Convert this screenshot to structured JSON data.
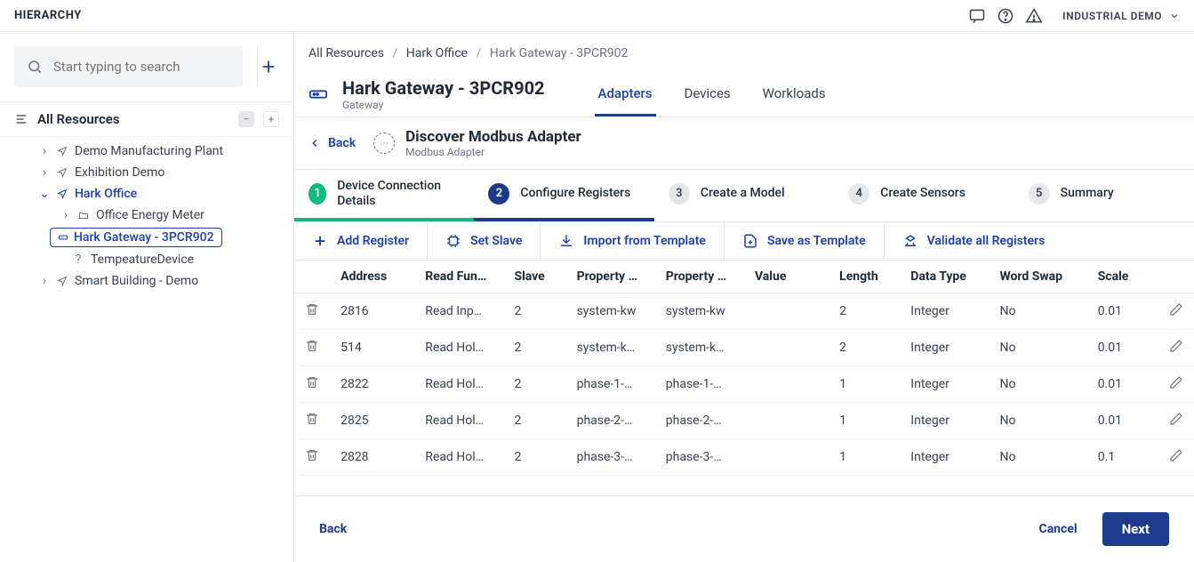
{
  "app": {
    "header_title": "HIERARCHY",
    "user_label": "INDUSTRIAL DEMO"
  },
  "sidebar": {
    "search_placeholder": "Start typing to search",
    "tree_header": "All Resources",
    "nodes": {
      "n0": {
        "label": "Demo Manufacturing Plant"
      },
      "n1": {
        "label": "Exhibition Demo"
      },
      "n2": {
        "label": "Hark Office"
      },
      "n2_0": {
        "label": "Office Energy Meter"
      },
      "n2_1": {
        "label": "Hark Gateway - 3PCR902"
      },
      "n2_2": {
        "label": "TempeatureDevice"
      },
      "n3": {
        "label": "Smart Building - Demo"
      }
    }
  },
  "breadcrumb": {
    "root": "All Resources",
    "parent": "Hark Office",
    "current": "Hark Gateway - 3PCR902"
  },
  "page": {
    "title": "Hark Gateway - 3PCR902",
    "subtitle": "Gateway",
    "tabs": {
      "adapters": "Adapters",
      "devices": "Devices",
      "workloads": "Workloads"
    }
  },
  "adapter_panel": {
    "back": "Back",
    "title": "Discover Modbus Adapter",
    "subtitle": "Modbus Adapter"
  },
  "stepper": {
    "s1": {
      "num": "1",
      "label": "Device Connection Details"
    },
    "s2": {
      "num": "2",
      "label": "Configure Registers"
    },
    "s3": {
      "num": "3",
      "label": "Create a Model"
    },
    "s4": {
      "num": "4",
      "label": "Create Sensors"
    },
    "s5": {
      "num": "5",
      "label": "Summary"
    }
  },
  "toolbar": {
    "add_register": "Add Register",
    "set_slave": "Set Slave",
    "import_template": "Import from Template",
    "save_template": "Save as Template",
    "validate": "Validate all Registers"
  },
  "table": {
    "headers": {
      "address": "Address",
      "read_fn": "Read Fun…",
      "slave": "Slave",
      "prop_name": "Property …",
      "prop_key": "Property …",
      "value": "Value",
      "length": "Length",
      "data_type": "Data Type",
      "word_swap": "Word Swap",
      "scale": "Scale"
    },
    "rows": [
      {
        "address": "2816",
        "read_fn": "Read Inp…",
        "slave": "2",
        "prop_name": "system-kw",
        "prop_key": "system-kw",
        "value": "",
        "length": "2",
        "data_type": "Integer",
        "word_swap": "No",
        "scale": "0.01"
      },
      {
        "address": "514",
        "read_fn": "Read Hol…",
        "slave": "2",
        "prop_name": "system-k…",
        "prop_key": "system-k…",
        "value": "",
        "length": "2",
        "data_type": "Integer",
        "word_swap": "No",
        "scale": "0.01"
      },
      {
        "address": "2822",
        "read_fn": "Read Hol…",
        "slave": "2",
        "prop_name": "phase-1-…",
        "prop_key": "phase-1-…",
        "value": "",
        "length": "1",
        "data_type": "Integer",
        "word_swap": "No",
        "scale": "0.01"
      },
      {
        "address": "2825",
        "read_fn": "Read Hol…",
        "slave": "2",
        "prop_name": "phase-2-…",
        "prop_key": "phase-2-…",
        "value": "",
        "length": "1",
        "data_type": "Integer",
        "word_swap": "No",
        "scale": "0.01"
      },
      {
        "address": "2828",
        "read_fn": "Read Hol…",
        "slave": "2",
        "prop_name": "phase-3-…",
        "prop_key": "phase-3-…",
        "value": "",
        "length": "1",
        "data_type": "Integer",
        "word_swap": "No",
        "scale": "0.1"
      }
    ]
  },
  "footer": {
    "back": "Back",
    "cancel": "Cancel",
    "next": "Next"
  }
}
